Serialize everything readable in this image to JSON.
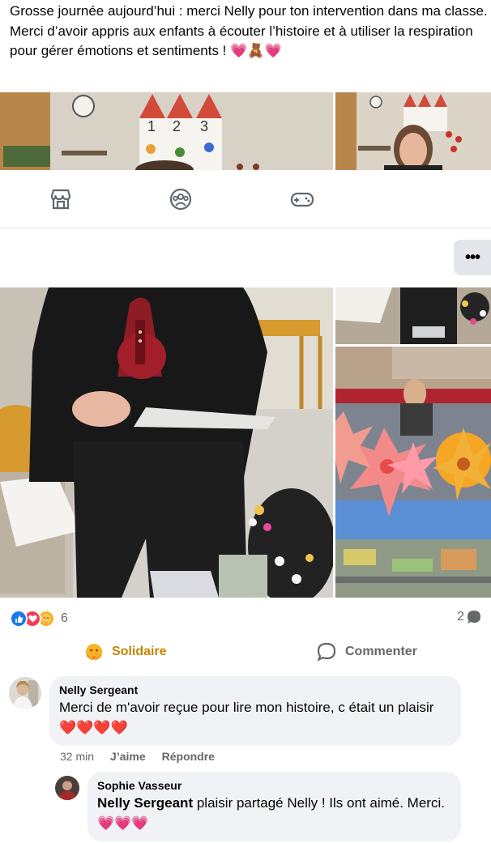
{
  "post": {
    "text_line1": "Grosse journée aujourd’hui : merci Nelly pour ton intervention dans ma classe.",
    "text_line2": "Merci d’avoir appris aux enfants à écouter l’histoire et à utiliser la respiration pour gérer émotions et sentiments ! 💗🧸💗"
  },
  "nav": {
    "icons": [
      "marketplace-icon",
      "groups-icon",
      "gaming-icon"
    ]
  },
  "more_button": "•••",
  "reactions": {
    "count": "6",
    "comments": "2",
    "types": [
      "like",
      "love",
      "care"
    ]
  },
  "actions": {
    "solidaire": "Solidaire",
    "comment": "Commenter"
  },
  "comments": [
    {
      "author": "Nelly Sergeant",
      "text": "Merci de m'avoir reçue pour lire mon histoire, c était un plaisir ❤️❤️❤️❤️",
      "time": "32 min",
      "like": "J’aime",
      "reply": "Répondre"
    },
    {
      "author": "Sophie Vasseur",
      "mention": "Nelly Sergeant",
      "text": " plaisir partagé Nelly ! Ils ont aimé. Merci.💗💗💗"
    }
  ],
  "colors": {
    "like_blue": "#1877f2",
    "love_red": "#f33e58",
    "care_yellow": "#f7b125",
    "secondary_text": "#65676b",
    "bubble_bg": "#f0f2f5"
  }
}
